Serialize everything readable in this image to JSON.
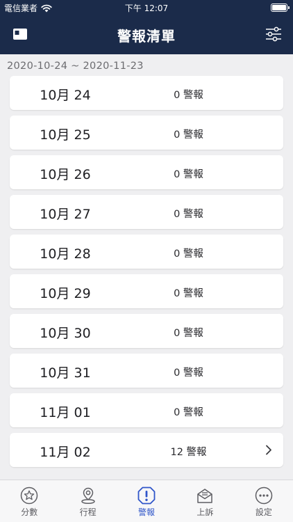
{
  "status_bar": {
    "carrier": "電信業者",
    "time": "下午 12:07"
  },
  "nav": {
    "title": "警報清單"
  },
  "date_range": "2020-10-24 ~ 2020-11-23",
  "rows": [
    {
      "date": "10月 24",
      "count": "0 警報"
    },
    {
      "date": "10月 25",
      "count": "0 警報"
    },
    {
      "date": "10月 26",
      "count": "0 警報"
    },
    {
      "date": "10月 27",
      "count": "0 警報"
    },
    {
      "date": "10月 28",
      "count": "0 警報"
    },
    {
      "date": "10月 29",
      "count": "0 警報"
    },
    {
      "date": "10月 30",
      "count": "0 警報"
    },
    {
      "date": "10月 31",
      "count": "0 警報"
    },
    {
      "date": "11月 01",
      "count": "0 警報"
    },
    {
      "date": "11月 02",
      "count": "12 警報"
    }
  ],
  "tabs": [
    {
      "label": "分數",
      "icon": "star-icon"
    },
    {
      "label": "行程",
      "icon": "location-pin-icon"
    },
    {
      "label": "警報",
      "icon": "alert-icon"
    },
    {
      "label": "上訴",
      "icon": "envelope-icon"
    },
    {
      "label": "設定",
      "icon": "more-icon"
    }
  ],
  "colors": {
    "header": "#1b2b4a",
    "background": "#efeff1",
    "active_tab": "#2f55c9",
    "inactive_tab": "#5d5d62"
  }
}
